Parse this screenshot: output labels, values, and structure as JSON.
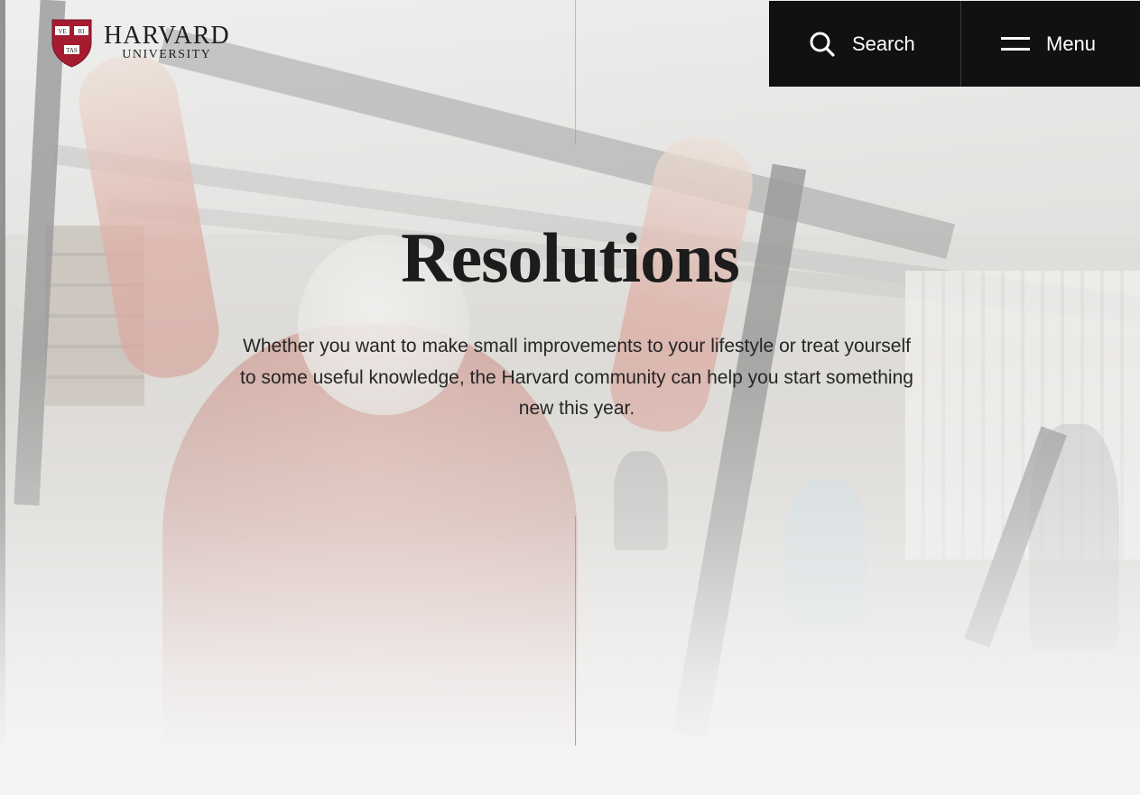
{
  "header": {
    "logo": {
      "name": "HARVARD",
      "subtitle": "UNIVERSITY",
      "shield_text": [
        "VE",
        "RI",
        "TAS"
      ],
      "shield_color": "#a51c30"
    },
    "nav": {
      "search_label": "Search",
      "menu_label": "Menu",
      "background": "#111111"
    }
  },
  "hero": {
    "title": "Resolutions",
    "intro": "Whether you want to make small improvements to your lifestyle or treat yourself to some useful knowledge, the Harvard community can help you start something new this year."
  },
  "icons": {
    "search": "search-icon",
    "menu": "hamburger-menu-icon"
  }
}
